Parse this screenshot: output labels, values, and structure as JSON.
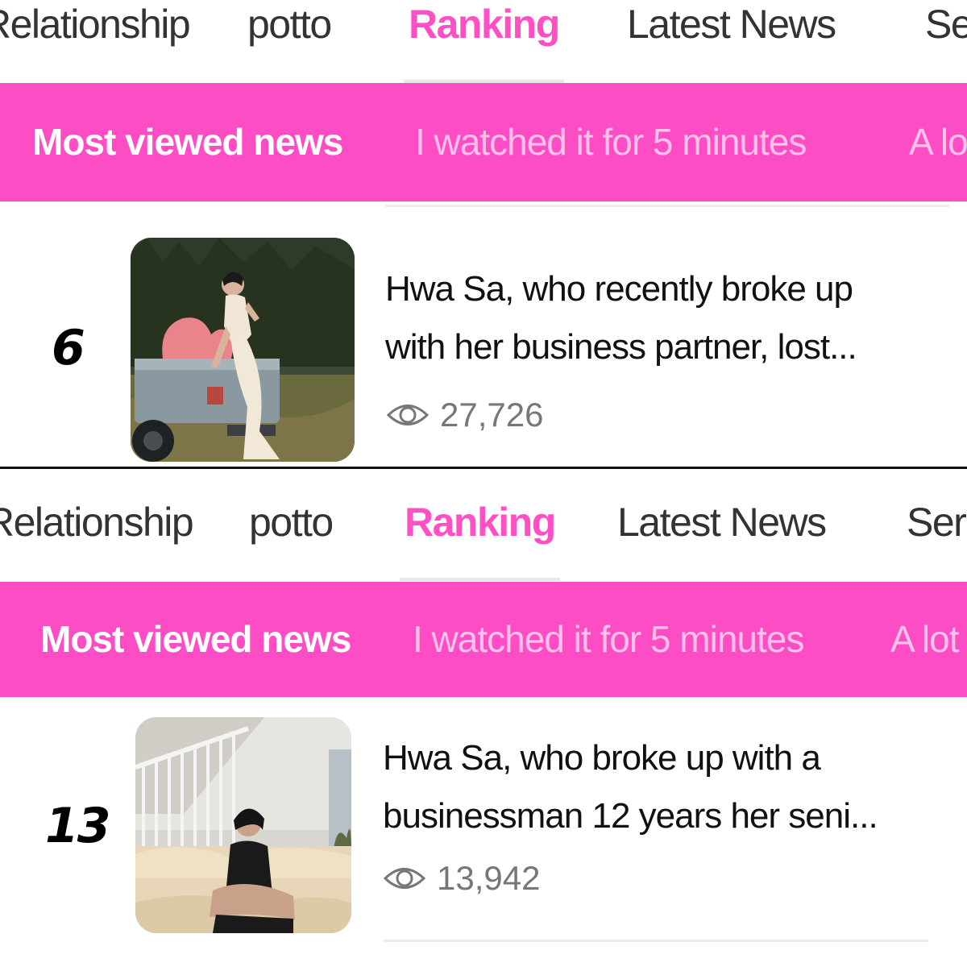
{
  "nav": {
    "tabs": [
      {
        "label": "Relationship"
      },
      {
        "label": "potto"
      },
      {
        "label": "Ranking",
        "active": true
      },
      {
        "label": "Latest News"
      },
      {
        "label": "Series"
      }
    ]
  },
  "subnav": {
    "tabs": [
      {
        "label": "Most viewed news",
        "active": true
      },
      {
        "label": "I watched it for 5 minutes"
      },
      {
        "label": "A lot"
      }
    ]
  },
  "articles": [
    {
      "rank": "6",
      "title_line1": "Hwa Sa, who recently broke up",
      "title_line2": "with her business partner, lost...",
      "views": "27,726",
      "thumbnail_icon": "photo-woman-on-truck"
    },
    {
      "rank": "13",
      "title_line1": "Hwa Sa, who broke up with a",
      "title_line2": "businessman 12 years her seni...",
      "views": "13,942",
      "thumbnail_icon": "photo-woman-on-sofa"
    }
  ],
  "colors": {
    "accent": "#fc4dc4",
    "active_tab": "#ff4fc4",
    "inactive_subtab": "#ffc1ea",
    "views_text": "#777777"
  }
}
